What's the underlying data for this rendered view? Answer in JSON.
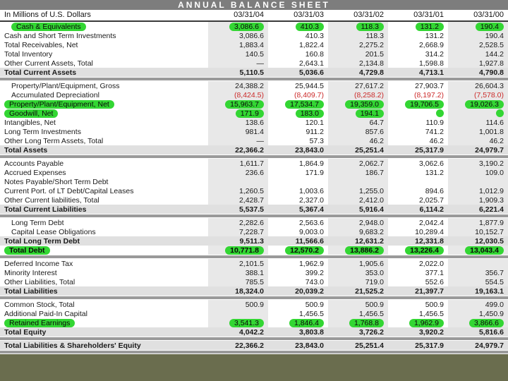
{
  "title": "ANNUAL BALANCE SHEET",
  "unit_label": "In Millions of U.S. Dollars",
  "columns": [
    "03/31/04",
    "03/31/03",
    "03/31/02",
    "03/31/01",
    "03/31/00"
  ],
  "colors": {
    "highlight_green": "#33d633",
    "negative_red": "#cc2a2a",
    "title_bar_gray": "#7d7d7d",
    "column_band_gray": "#e8e8e8",
    "total_band_gray": "#e0e0e0",
    "separator_gray": "#9a9a9a"
  },
  "rows": [
    {
      "label": "Cash & Equivalents",
      "values": [
        "3,086.6",
        "410.3",
        "118.3",
        "131.2",
        "190.4"
      ],
      "indent": 1,
      "hl_label": true,
      "hl_values": [
        1,
        1,
        1,
        1,
        1
      ]
    },
    {
      "label": "Cash and Short Term Investments",
      "values": [
        "3,086.6",
        "410.3",
        "118.3",
        "131.2",
        "190.4"
      ]
    },
    {
      "label": "Total Receivables, Net",
      "values": [
        "1,883.4",
        "1,822.4",
        "2,275.2",
        "2,668.9",
        "2,528.5"
      ]
    },
    {
      "label": "Total Inventory",
      "values": [
        "140.5",
        "160.8",
        "201.5",
        "314.2",
        "144.2"
      ]
    },
    {
      "label": "Other Current Assets, Total",
      "values": [
        "—",
        "2,643.1",
        "2,134.8",
        "1,598.8",
        "1,927.8"
      ]
    },
    {
      "label": "Total Current Assets",
      "values": [
        "5,110.5",
        "5,036.6",
        "4,729.8",
        "4,713.1",
        "4,790.8"
      ],
      "total": true,
      "sep_after": true
    },
    {
      "label": "Property/Plant/Equipment, Gross",
      "values": [
        "24,388.2",
        "25,944.5",
        "27,617.2",
        "27,903.7",
        "26,604.3"
      ],
      "indent": 1
    },
    {
      "label": "Accumulated Depreciationl",
      "values": [
        "(8,424.5)",
        "(8,409.7)",
        "(8,258.2)",
        "(8,197.2)",
        "(7,578.0)"
      ],
      "indent": 1,
      "red": true
    },
    {
      "label": "Property/Plant/Equipment, Net",
      "values": [
        "15,963.7",
        "17,534.7",
        "19,359.0",
        "19,706.5",
        "19,026.3"
      ],
      "hl_label": true,
      "hl_values": [
        1,
        1,
        1,
        1,
        1
      ]
    },
    {
      "label": "Goodwill, Net",
      "values": [
        "171.9",
        "183.0",
        "194.1",
        "",
        ""
      ],
      "hl_label": true,
      "hl_values": [
        1,
        1,
        1,
        0,
        0
      ],
      "dots": [
        0,
        0,
        0,
        1,
        1
      ]
    },
    {
      "label": "Intangibles, Net",
      "values": [
        "138.6",
        "120.1",
        "64.7",
        "110.9",
        "114.6"
      ]
    },
    {
      "label": "Long Term Investments",
      "values": [
        "981.4",
        "911.2",
        "857.6",
        "741.2",
        "1,001.8"
      ]
    },
    {
      "label": "Other Long Term Assets, Total",
      "values": [
        "—",
        "57.3",
        "46.2",
        "46.2",
        "46.2"
      ]
    },
    {
      "label": "Total Assets",
      "values": [
        "22,366.2",
        "23,843.0",
        "25,251.4",
        "25,317.9",
        "24,979.7"
      ],
      "total": true,
      "sep_after": true
    },
    {
      "label": "Accounts Payable",
      "values": [
        "1,611.7",
        "1,864.9",
        "2,062.7",
        "3,062.6",
        "3,190.2"
      ]
    },
    {
      "label": "Accrued Expenses",
      "values": [
        "236.6",
        "171.9",
        "186.7",
        "131.2",
        "109.0"
      ]
    },
    {
      "label": "Notes Payable/Short Term Debt",
      "values": [
        "",
        "",
        "",
        "",
        ""
      ]
    },
    {
      "label": "Current Port. of LT Debt/Capital Leases",
      "values": [
        "1,260.5",
        "1,003.6",
        "1,255.0",
        "894.6",
        "1,012.9"
      ]
    },
    {
      "label": "Other Current liabilities, Total",
      "values": [
        "2,428.7",
        "2,327.0",
        "2,412.0",
        "2,025.7",
        "1,909.3"
      ]
    },
    {
      "label": "Total Current Liabilities",
      "values": [
        "5,537.5",
        "5,367.4",
        "5,916.4",
        "6,114.2",
        "6,221.4"
      ],
      "total": true,
      "sep_after": true
    },
    {
      "label": "Long Term Debt",
      "values": [
        "2,282.6",
        "2,563.6",
        "2,948.0",
        "2,042.4",
        "1,877.9"
      ],
      "indent": 1
    },
    {
      "label": "Capital Lease Obligations",
      "values": [
        "7,228.7",
        "9,003.0",
        "9,683.2",
        "10,289.4",
        "10,152.7"
      ],
      "indent": 1
    },
    {
      "label": "Total Long Term Debt",
      "values": [
        "9,511.3",
        "11,566.6",
        "12,631.2",
        "12,331.8",
        "12,030.5"
      ],
      "total": true
    },
    {
      "label": "Total Debt",
      "values": [
        "10,771.8",
        "12,570.2",
        "13,886.2",
        "13,226.4",
        "13,043.4"
      ],
      "bold": true,
      "hl_label": true,
      "hl_values": [
        1,
        1,
        1,
        1,
        1
      ],
      "sep_after": true
    },
    {
      "label": "Deferred Income Tax",
      "values": [
        "2,101.5",
        "1,962.9",
        "1,905.6",
        "2,022.0",
        ""
      ]
    },
    {
      "label": "Minority Interest",
      "values": [
        "388.1",
        "399.2",
        "353.0",
        "377.1",
        "356.7"
      ]
    },
    {
      "label": "Other Liabilities, Total",
      "values": [
        "785.5",
        "743.0",
        "719.0",
        "552.6",
        "554.5"
      ]
    },
    {
      "label": "Total Liabilities",
      "values": [
        "18,324.0",
        "20,039.2",
        "21,525.2",
        "21,397.7",
        "19,163.1"
      ],
      "total": true,
      "sep_after": true
    },
    {
      "label": "Common Stock, Total",
      "values": [
        "500.9",
        "500.9",
        "500.9",
        "500.9",
        "499.0"
      ]
    },
    {
      "label": "Additional Paid-In Capital",
      "values": [
        "",
        "1,456.5",
        "1,456.5",
        "1,456.5",
        "1,450.9"
      ]
    },
    {
      "label": "Retained Earnings",
      "values": [
        "3,541.3",
        "1,846.4",
        "1,768.8",
        "1,962.9",
        "3,866.6"
      ],
      "hl_label": true,
      "hl_values": [
        1,
        1,
        1,
        1,
        1
      ]
    },
    {
      "label": "Total Equity",
      "values": [
        "4,042.2",
        "3,803.8",
        "3,726.2",
        "3,920.2",
        "5,816.6"
      ],
      "total": true,
      "sep_after": true
    },
    {
      "label": "Total Liabilities & Shareholders' Equity",
      "values": [
        "22,366.2",
        "23,843.0",
        "25,251.4",
        "25,317.9",
        "24,979.7"
      ],
      "total": true,
      "sep_after": true
    }
  ]
}
